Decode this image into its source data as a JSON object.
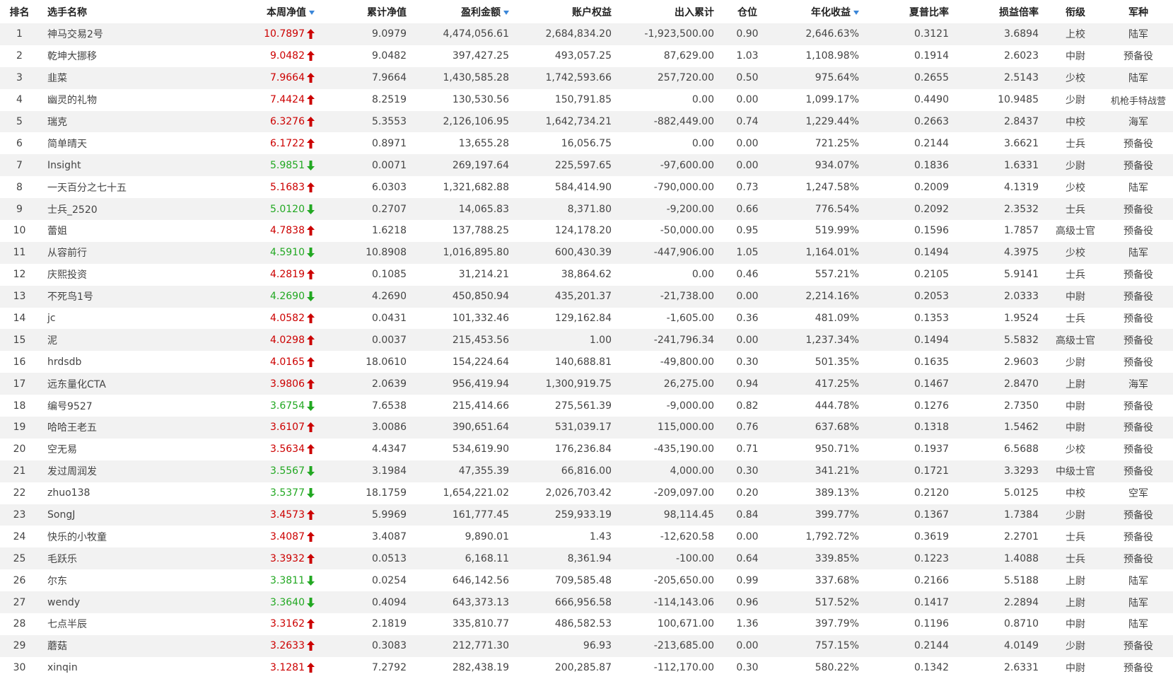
{
  "headers": {
    "rank": "排名",
    "name": "选手名称",
    "week_nav": "本周净值",
    "cum_nav": "累计净值",
    "profit": "盈利金额",
    "equity": "账户权益",
    "inout": "出入累计",
    "position": "仓位",
    "annual": "年化收益",
    "sharpe": "夏普比率",
    "plratio": "损益倍率",
    "rank_title": "衔级",
    "army": "军种"
  },
  "colors": {
    "up": "#cc0000",
    "down": "#22a822",
    "sort_arrow": "#3a86d8",
    "zebra": "#f2f2f2"
  },
  "rows": [
    {
      "rank": "1",
      "name": "神马交易2号",
      "week": "10.7897",
      "dir": "up",
      "cum": "9.0979",
      "profit": "4,474,056.61",
      "equity": "2,684,834.20",
      "inout": "-1,923,500.00",
      "pos": "0.90",
      "annual": "2,646.63%",
      "sharpe": "0.3121",
      "pl": "3.6894",
      "title": "上校",
      "army": "陆军"
    },
    {
      "rank": "2",
      "name": "乾坤大挪移",
      "week": "9.0482",
      "dir": "up",
      "cum": "9.0482",
      "profit": "397,427.25",
      "equity": "493,057.25",
      "inout": "87,629.00",
      "pos": "1.03",
      "annual": "1,108.98%",
      "sharpe": "0.1914",
      "pl": "2.6023",
      "title": "中尉",
      "army": "预备役"
    },
    {
      "rank": "3",
      "name": "韭菜",
      "week": "7.9664",
      "dir": "up",
      "cum": "7.9664",
      "profit": "1,430,585.28",
      "equity": "1,742,593.66",
      "inout": "257,720.00",
      "pos": "0.50",
      "annual": "975.64%",
      "sharpe": "0.2655",
      "pl": "2.5143",
      "title": "少校",
      "army": "陆军"
    },
    {
      "rank": "4",
      "name": "幽灵的礼物",
      "week": "7.4424",
      "dir": "up",
      "cum": "8.2519",
      "profit": "130,530.56",
      "equity": "150,791.85",
      "inout": "0.00",
      "pos": "0.00",
      "annual": "1,099.17%",
      "sharpe": "0.4490",
      "pl": "10.9485",
      "title": "少尉",
      "army": "机枪手特战营"
    },
    {
      "rank": "5",
      "name": "瑞克",
      "week": "6.3276",
      "dir": "up",
      "cum": "5.3553",
      "profit": "2,126,106.95",
      "equity": "1,642,734.21",
      "inout": "-882,449.00",
      "pos": "0.74",
      "annual": "1,229.44%",
      "sharpe": "0.2663",
      "pl": "2.8437",
      "title": "中校",
      "army": "海军"
    },
    {
      "rank": "6",
      "name": "简单晴天",
      "week": "6.1722",
      "dir": "up",
      "cum": "0.8971",
      "profit": "13,655.28",
      "equity": "16,056.75",
      "inout": "0.00",
      "pos": "0.00",
      "annual": "721.25%",
      "sharpe": "0.2144",
      "pl": "3.6621",
      "title": "士兵",
      "army": "预备役"
    },
    {
      "rank": "7",
      "name": "Insight",
      "week": "5.9851",
      "dir": "down",
      "cum": "0.0071",
      "profit": "269,197.64",
      "equity": "225,597.65",
      "inout": "-97,600.00",
      "pos": "0.00",
      "annual": "934.07%",
      "sharpe": "0.1836",
      "pl": "1.6331",
      "title": "少尉",
      "army": "预备役"
    },
    {
      "rank": "8",
      "name": "一天百分之七十五",
      "week": "5.1683",
      "dir": "up",
      "cum": "6.0303",
      "profit": "1,321,682.88",
      "equity": "584,414.90",
      "inout": "-790,000.00",
      "pos": "0.73",
      "annual": "1,247.58%",
      "sharpe": "0.2009",
      "pl": "4.1319",
      "title": "少校",
      "army": "陆军"
    },
    {
      "rank": "9",
      "name": "士兵_2520",
      "week": "5.0120",
      "dir": "down",
      "cum": "0.2707",
      "profit": "14,065.83",
      "equity": "8,371.80",
      "inout": "-9,200.00",
      "pos": "0.66",
      "annual": "776.54%",
      "sharpe": "0.2092",
      "pl": "2.3532",
      "title": "士兵",
      "army": "预备役"
    },
    {
      "rank": "10",
      "name": "蕾姐",
      "week": "4.7838",
      "dir": "up",
      "cum": "1.6218",
      "profit": "137,788.25",
      "equity": "124,178.20",
      "inout": "-50,000.00",
      "pos": "0.95",
      "annual": "519.99%",
      "sharpe": "0.1596",
      "pl": "1.7857",
      "title": "高级士官",
      "army": "预备役"
    },
    {
      "rank": "11",
      "name": "从容前行",
      "week": "4.5910",
      "dir": "down",
      "cum": "10.8908",
      "profit": "1,016,895.80",
      "equity": "600,430.39",
      "inout": "-447,906.00",
      "pos": "1.05",
      "annual": "1,164.01%",
      "sharpe": "0.1494",
      "pl": "4.3975",
      "title": "少校",
      "army": "陆军"
    },
    {
      "rank": "12",
      "name": "庆熙投资",
      "week": "4.2819",
      "dir": "up",
      "cum": "0.1085",
      "profit": "31,214.21",
      "equity": "38,864.62",
      "inout": "0.00",
      "pos": "0.46",
      "annual": "557.21%",
      "sharpe": "0.2105",
      "pl": "5.9141",
      "title": "士兵",
      "army": "预备役"
    },
    {
      "rank": "13",
      "name": "不死鸟1号",
      "week": "4.2690",
      "dir": "down",
      "cum": "4.2690",
      "profit": "450,850.94",
      "equity": "435,201.37",
      "inout": "-21,738.00",
      "pos": "0.00",
      "annual": "2,214.16%",
      "sharpe": "0.2053",
      "pl": "2.0333",
      "title": "中尉",
      "army": "预备役"
    },
    {
      "rank": "14",
      "name": "jc",
      "week": "4.0582",
      "dir": "up",
      "cum": "0.0431",
      "profit": "101,332.46",
      "equity": "129,162.84",
      "inout": "-1,605.00",
      "pos": "0.36",
      "annual": "481.09%",
      "sharpe": "0.1353",
      "pl": "1.9524",
      "title": "士兵",
      "army": "预备役"
    },
    {
      "rank": "15",
      "name": "泥",
      "week": "4.0298",
      "dir": "up",
      "cum": "0.0037",
      "profit": "215,453.56",
      "equity": "1.00",
      "inout": "-241,796.34",
      "pos": "0.00",
      "annual": "1,237.34%",
      "sharpe": "0.1494",
      "pl": "5.5832",
      "title": "高级士官",
      "army": "预备役"
    },
    {
      "rank": "16",
      "name": "hrdsdb",
      "week": "4.0165",
      "dir": "up",
      "cum": "18.0610",
      "profit": "154,224.64",
      "equity": "140,688.81",
      "inout": "-49,800.00",
      "pos": "0.30",
      "annual": "501.35%",
      "sharpe": "0.1635",
      "pl": "2.9603",
      "title": "少尉",
      "army": "预备役"
    },
    {
      "rank": "17",
      "name": "远东量化CTA",
      "week": "3.9806",
      "dir": "up",
      "cum": "2.0639",
      "profit": "956,419.94",
      "equity": "1,300,919.75",
      "inout": "26,275.00",
      "pos": "0.94",
      "annual": "417.25%",
      "sharpe": "0.1467",
      "pl": "2.8470",
      "title": "上尉",
      "army": "海军"
    },
    {
      "rank": "18",
      "name": "编号9527",
      "week": "3.6754",
      "dir": "down",
      "cum": "7.6538",
      "profit": "215,414.66",
      "equity": "275,561.39",
      "inout": "-9,000.00",
      "pos": "0.82",
      "annual": "444.78%",
      "sharpe": "0.1276",
      "pl": "2.7350",
      "title": "中尉",
      "army": "预备役"
    },
    {
      "rank": "19",
      "name": "哈哈王老五",
      "week": "3.6107",
      "dir": "up",
      "cum": "3.0086",
      "profit": "390,651.64",
      "equity": "531,039.17",
      "inout": "115,000.00",
      "pos": "0.76",
      "annual": "637.68%",
      "sharpe": "0.1318",
      "pl": "1.5462",
      "title": "中尉",
      "army": "预备役"
    },
    {
      "rank": "20",
      "name": "空无易",
      "week": "3.5634",
      "dir": "up",
      "cum": "4.4347",
      "profit": "534,619.90",
      "equity": "176,236.84",
      "inout": "-435,190.00",
      "pos": "0.71",
      "annual": "950.71%",
      "sharpe": "0.1937",
      "pl": "6.5688",
      "title": "少校",
      "army": "预备役"
    },
    {
      "rank": "21",
      "name": "发过周润发",
      "week": "3.5567",
      "dir": "down",
      "cum": "3.1984",
      "profit": "47,355.39",
      "equity": "66,816.00",
      "inout": "4,000.00",
      "pos": "0.30",
      "annual": "341.21%",
      "sharpe": "0.1721",
      "pl": "3.3293",
      "title": "中级士官",
      "army": "预备役"
    },
    {
      "rank": "22",
      "name": "zhuo138",
      "week": "3.5377",
      "dir": "down",
      "cum": "18.1759",
      "profit": "1,654,221.02",
      "equity": "2,026,703.42",
      "inout": "-209,097.00",
      "pos": "0.20",
      "annual": "389.13%",
      "sharpe": "0.2120",
      "pl": "5.0125",
      "title": "中校",
      "army": "空军"
    },
    {
      "rank": "23",
      "name": "SongJ",
      "week": "3.4573",
      "dir": "up",
      "cum": "5.9969",
      "profit": "161,777.45",
      "equity": "259,933.19",
      "inout": "98,114.45",
      "pos": "0.84",
      "annual": "399.77%",
      "sharpe": "0.1367",
      "pl": "1.7384",
      "title": "少尉",
      "army": "预备役"
    },
    {
      "rank": "24",
      "name": "快乐的小牧童",
      "week": "3.4087",
      "dir": "up",
      "cum": "3.4087",
      "profit": "9,890.01",
      "equity": "1.43",
      "inout": "-12,620.58",
      "pos": "0.00",
      "annual": "1,792.72%",
      "sharpe": "0.3619",
      "pl": "2.2701",
      "title": "士兵",
      "army": "预备役"
    },
    {
      "rank": "25",
      "name": "毛跃乐",
      "week": "3.3932",
      "dir": "up",
      "cum": "0.0513",
      "profit": "6,168.11",
      "equity": "8,361.94",
      "inout": "-100.00",
      "pos": "0.64",
      "annual": "339.85%",
      "sharpe": "0.1223",
      "pl": "1.4088",
      "title": "士兵",
      "army": "预备役"
    },
    {
      "rank": "26",
      "name": "尔东",
      "week": "3.3811",
      "dir": "down",
      "cum": "0.0254",
      "profit": "646,142.56",
      "equity": "709,585.48",
      "inout": "-205,650.00",
      "pos": "0.99",
      "annual": "337.68%",
      "sharpe": "0.2166",
      "pl": "5.5188",
      "title": "上尉",
      "army": "陆军"
    },
    {
      "rank": "27",
      "name": "wendy",
      "week": "3.3640",
      "dir": "down",
      "cum": "0.4094",
      "profit": "643,373.13",
      "equity": "666,956.58",
      "inout": "-114,143.06",
      "pos": "0.96",
      "annual": "517.52%",
      "sharpe": "0.1417",
      "pl": "2.2894",
      "title": "上尉",
      "army": "陆军"
    },
    {
      "rank": "28",
      "name": "七点半辰",
      "week": "3.3162",
      "dir": "up",
      "cum": "2.1819",
      "profit": "335,810.77",
      "equity": "486,582.53",
      "inout": "100,671.00",
      "pos": "1.36",
      "annual": "397.79%",
      "sharpe": "0.1196",
      "pl": "0.8710",
      "title": "中尉",
      "army": "陆军"
    },
    {
      "rank": "29",
      "name": "蘑菇",
      "week": "3.2633",
      "dir": "up",
      "cum": "0.3083",
      "profit": "212,771.30",
      "equity": "96.93",
      "inout": "-213,685.00",
      "pos": "0.00",
      "annual": "757.15%",
      "sharpe": "0.2144",
      "pl": "4.0149",
      "title": "少尉",
      "army": "预备役"
    },
    {
      "rank": "30",
      "name": "xinqin",
      "week": "3.1281",
      "dir": "up",
      "cum": "7.2792",
      "profit": "282,438.19",
      "equity": "200,285.87",
      "inout": "-112,170.00",
      "pos": "0.30",
      "annual": "580.22%",
      "sharpe": "0.1342",
      "pl": "2.6331",
      "title": "中尉",
      "army": "预备役"
    }
  ]
}
